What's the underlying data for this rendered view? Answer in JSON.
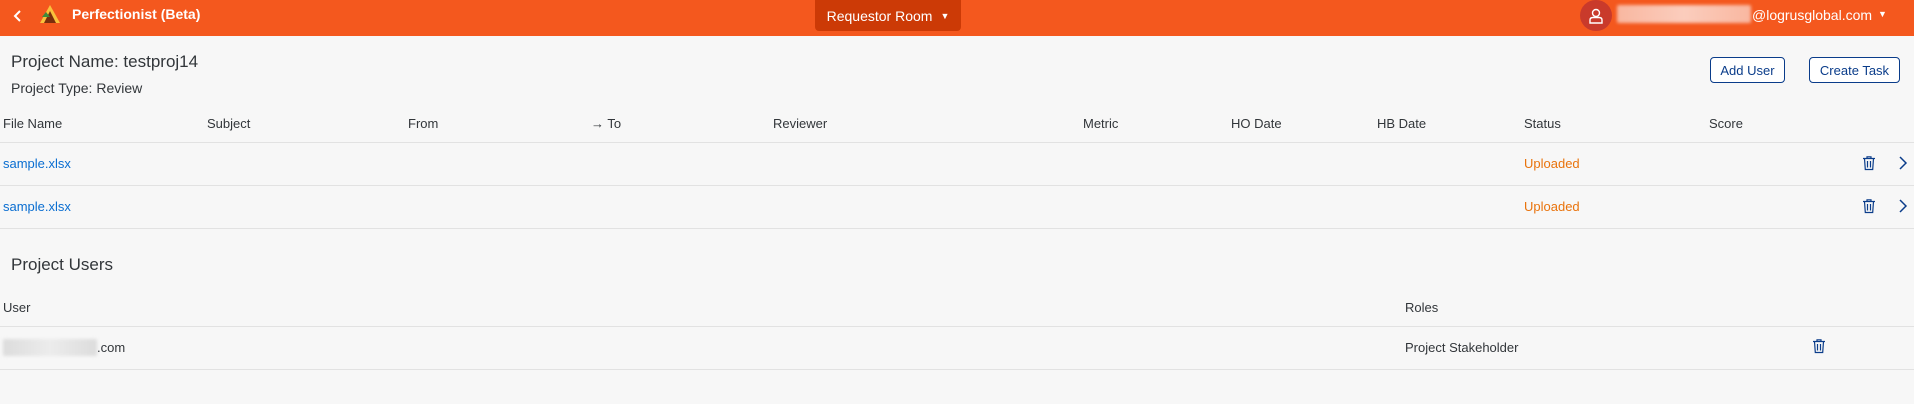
{
  "header": {
    "app_title": "Perfectionist (Beta)",
    "room_label": "Requestor Room",
    "user_email_suffix": "@logrusglobal.com",
    "icons": {
      "back": "chevron-left-icon",
      "logo": "perfectionist-logo",
      "avatar": "user-icon",
      "room_caret": "caret-down-icon",
      "user_caret": "caret-down-icon"
    },
    "colors": {
      "bar": "#f4581e",
      "room_button": "#cc3a06",
      "avatar": "#c93a2b"
    }
  },
  "project": {
    "name_label": "Project Name: testproj14",
    "type_label": "Project Type: Review",
    "add_user_label": "Add User",
    "create_task_label": "Create Task"
  },
  "files_table": {
    "columns": [
      "File Name",
      "Subject",
      "From",
      "→ To",
      "Reviewer",
      "Metric",
      "HO Date",
      "HB Date",
      "Status",
      "Score"
    ],
    "rows": [
      {
        "file_name": "sample.xlsx",
        "subject": "",
        "from": "",
        "to": "",
        "reviewer": "",
        "metric": "",
        "ho_date": "",
        "hb_date": "",
        "status": "Uploaded",
        "score": ""
      },
      {
        "file_name": "sample.xlsx",
        "subject": "",
        "from": "",
        "to": "",
        "reviewer": "",
        "metric": "",
        "ho_date": "",
        "hb_date": "",
        "status": "Uploaded",
        "score": ""
      }
    ],
    "status_color": "#e9730c",
    "link_color": "#0a6ed1"
  },
  "users_section": {
    "title": "Project Users",
    "columns": [
      "User",
      "Roles"
    ],
    "rows": [
      {
        "user_suffix": ".com",
        "role": "Project Stakeholder"
      }
    ]
  }
}
